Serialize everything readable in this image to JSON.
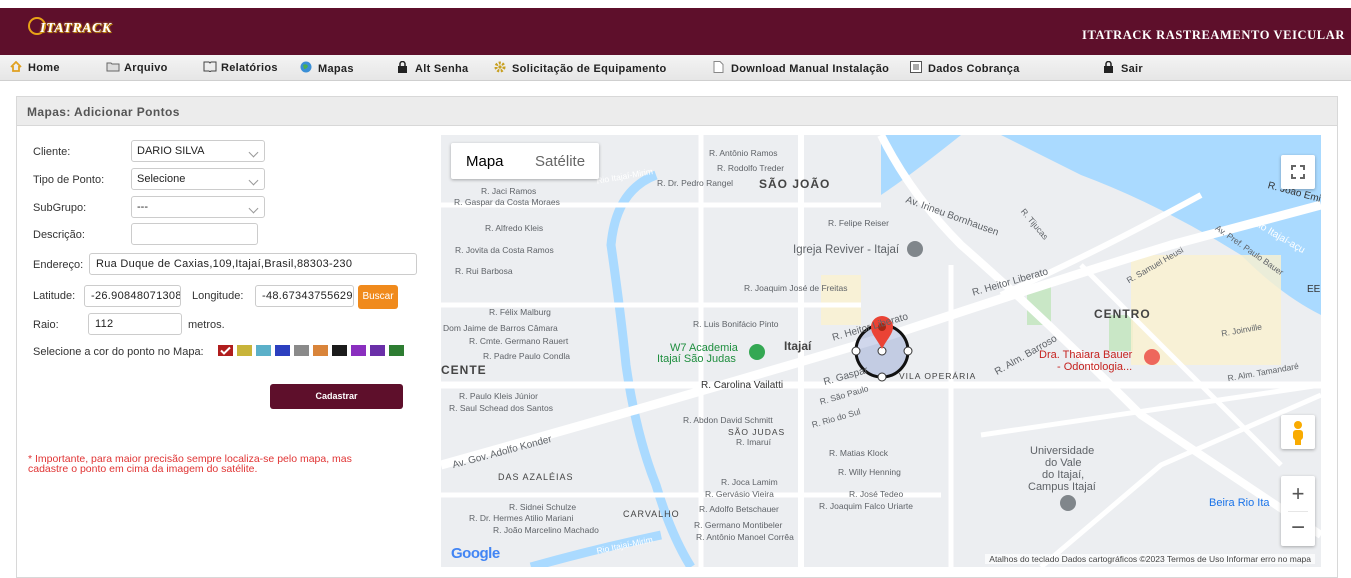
{
  "header": {
    "logo_text": "ITATRACK",
    "logo_subtext": "RASTREAMENTO VEICULAR",
    "brand_title": "ITATRACK RASTREAMENTO VEICULAR",
    "color": "#5e0f2b"
  },
  "nav": {
    "home": "Home",
    "arquivo": "Arquivo",
    "relatorios": "Relatórios",
    "mapas": "Mapas",
    "alt_senha": "Alt Senha",
    "solicitacao": "Solicitação de Equipamento",
    "download": "Download Manual Instalação",
    "dados_cobranca": "Dados Cobrança",
    "sair": "Sair"
  },
  "panel": {
    "title": "Mapas: Adicionar Pontos"
  },
  "form": {
    "cliente_label": "Cliente:",
    "cliente_value": "DARIO SILVA",
    "tipo_label": "Tipo de Ponto:",
    "tipo_value": "Selecione",
    "subgrupo_label": "SubGrupo:",
    "subgrupo_value": "---",
    "descricao_label": "Descrição:",
    "descricao_value": "",
    "endereco_label": "Endereço:",
    "endereco_value": "Rua Duque de Caxias,109,Itajaí,Brasil,88303-230",
    "latitude_label": "Latitude:",
    "latitude_value": "-26.90848071308",
    "longitude_label": "Longitude:",
    "longitude_value": "-48.67343755629",
    "buscar_label": "Buscar",
    "raio_label": "Raio:",
    "raio_value": "112",
    "metros_label": "metros.",
    "cor_label": "Selecione a cor do ponto no Mapa:",
    "colors": [
      "#b01d1d",
      "#c8b43a",
      "#5bb0c9",
      "#2c3fbf",
      "#8a8a8a",
      "#d9843a",
      "#1b1b1b",
      "#8a2fbf",
      "#6a2fa8",
      "#2e7d32"
    ],
    "selected_color": "#b01d1d",
    "cadastrar_label": "Cadastrar",
    "warning": "* Importante, para maior precisão sempre localiza-se pelo mapa, mas cadastre o ponto em cima da imagem do satélite."
  },
  "map": {
    "type_map": "Mapa",
    "type_satellite": "Satélite",
    "areas": {
      "sao_joao": "SÃO JOÃO",
      "centro": "CENTRO",
      "cente": "CENTE",
      "itajai": "Itajaí",
      "das_azaleias": "DAS AZALÉIAS",
      "carvalho": "CARVALHO",
      "vila_operaria": "VILA OPERÁRIA",
      "sao_judas": "SÃO JUDAS"
    },
    "streets": {
      "s1": "R. Antônio Ramos",
      "s2": "R. Rodolfo Treder",
      "s3": "R. Dr. Pedro Rangel",
      "s4": "R. Jaci Ramos",
      "s5": "R. Gaspar da Costa Moraes",
      "s6": "R. Alfredo Kleis",
      "s7": "R. Jovita da Costa Ramos",
      "s8": "R. Rui Barbosa",
      "s9": "R. Félix Malburg",
      "s10": "Dom Jaime de Barros Câmara",
      "s11": "R. Cmte. Germano Rauert",
      "s12": "R. Padre Paulo Condla",
      "s13": "R. Paulo Kleis Júnior",
      "s14": "R. Saul Schead dos Santos",
      "s15": "Av. Gov. Adolfo Konder",
      "s16": "R. Sidnei Schulze",
      "s17": "R. Dr. Hermes Atilio Mariani",
      "s18": "R. João Marcelino Machado",
      "s19": "Rio Itajaí-Mirim",
      "s20": "R. Felipe Reiser",
      "s21": "Av. Irineu Bornhausen",
      "s22": "R. Heitor Liberato",
      "s23": "R. Joaquim José de Freitas",
      "s24": "R. Luis Bonifácio Pinto",
      "s25": "R. Carolina Vailatti",
      "s26": "R. Gaspar",
      "s27": "R. São Paulo",
      "s28": "R. Rio do Sul",
      "s29": "R. Abdon David Schmitt",
      "s30": "R. Imaruí",
      "s31": "R. Matias Klock",
      "s32": "R. Willy Henning",
      "s33": "R. Joca Lamim",
      "s34": "R. Gervásio Vieira",
      "s35": "R. Adolfo Betschauer",
      "s36": "R. Germano Montibeler",
      "s37": "R. Antônio Manoel Corrêa",
      "s38": "R. José Tedeo",
      "s39": "R. Joaquim Falco Uriarte",
      "s40": "R. Alm. Barroso",
      "s41": "R. Samuel Heusi",
      "s42": "R. Alm. Tamandaré",
      "s43": "R. Joinville",
      "s44": "R. João Emi",
      "s45": "Rio Itajaí-açu",
      "s46": "R. Tijucas",
      "s47": "Av. Pref. Paulo Bauer"
    },
    "places": {
      "igreja": "Igreja Reviver - Itajaí",
      "academia1": "W7 Academia",
      "academia2": "Itajaí São Judas",
      "clinica1": "Dra. Thaiara Bauer",
      "clinica2": "- Odontologia...",
      "univ1": "Universidade",
      "univ2": "do Vale",
      "univ3": "do Itajaí,",
      "univ4": "Campus Itajaí",
      "beira": "Beira Rio Ita",
      "ee": "EE"
    },
    "google_logo": "Google",
    "footer": "Atalhos do teclado   Dados cartográficos ©2023   Termos de Uso   Informar erro no mapa"
  }
}
